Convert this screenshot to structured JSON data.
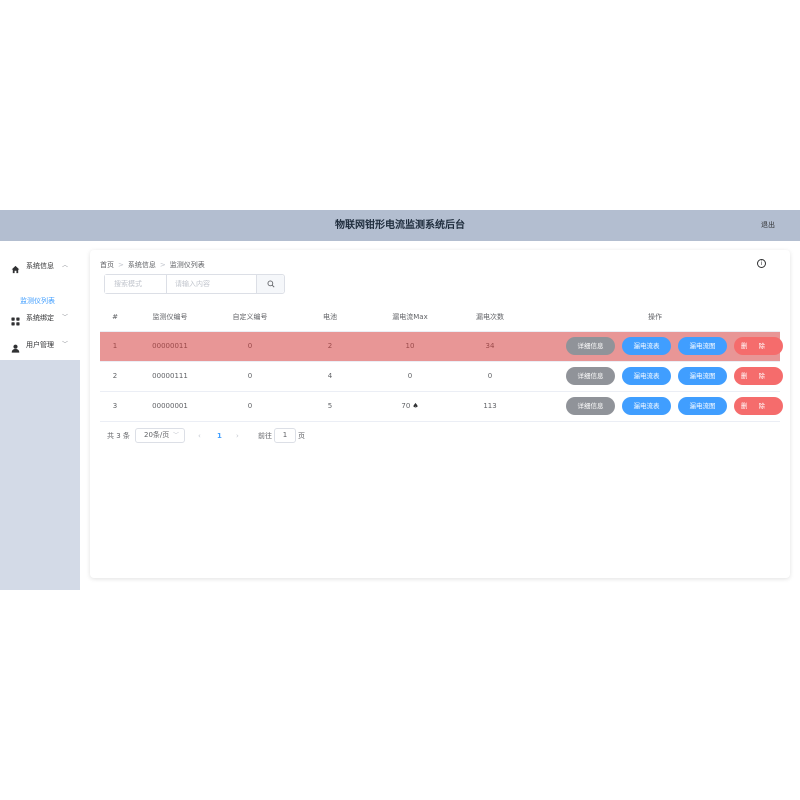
{
  "header": {
    "title": "物联网钳形电流监测系统后台",
    "logout_label": "退出"
  },
  "sidebar": {
    "items": [
      {
        "label": "系统信息",
        "icon": "home-icon",
        "arrow": "︿"
      },
      {
        "label": "系统绑定",
        "icon": "grid-icon",
        "arrow": "﹀"
      },
      {
        "label": "用户管理",
        "icon": "user-icon",
        "arrow": "﹀"
      }
    ],
    "submenu_item": "监测仪列表"
  },
  "breadcrumb": {
    "items": [
      "首页",
      "系统信息",
      "监测仪列表"
    ],
    "separator": ">"
  },
  "search": {
    "mode_placeholder": "搜索模式",
    "placeholder": "请输入内容"
  },
  "table": {
    "columns": [
      "#",
      "监测仪编号",
      "自定义编号",
      "电池",
      "漏电流Max",
      "漏电次数",
      "操作"
    ],
    "rows": [
      {
        "index": "1",
        "device_no": "00000011",
        "custom_no": "0",
        "battery": "2",
        "leak_max": "10",
        "leak_count": "34",
        "leak_mark": "",
        "highlight": true
      },
      {
        "index": "2",
        "device_no": "00000111",
        "custom_no": "0",
        "battery": "4",
        "leak_max": "0",
        "leak_count": "0",
        "leak_mark": "",
        "highlight": false
      },
      {
        "index": "3",
        "device_no": "00000001",
        "custom_no": "0",
        "battery": "5",
        "leak_max": "70",
        "leak_count": "113",
        "leak_mark": "♠",
        "highlight": false
      }
    ],
    "actions": {
      "detail": "详细信息",
      "flow_table": "漏电流表",
      "flow_chart": "漏电流图",
      "delete": "删除"
    }
  },
  "pagination": {
    "total": "共 3 条",
    "page_size": "20条/页",
    "prev": "‹",
    "current_page": "1",
    "next": "›",
    "goto_label": "前往",
    "goto_value": "1",
    "page_unit": "页"
  },
  "colors": {
    "header_bg": "#b3bed0",
    "sidebar_bg": "#d3dae7",
    "accent": "#409eff",
    "danger": "#f56c6c",
    "highlight_row": "#e89696",
    "neutral_button": "#909399"
  }
}
